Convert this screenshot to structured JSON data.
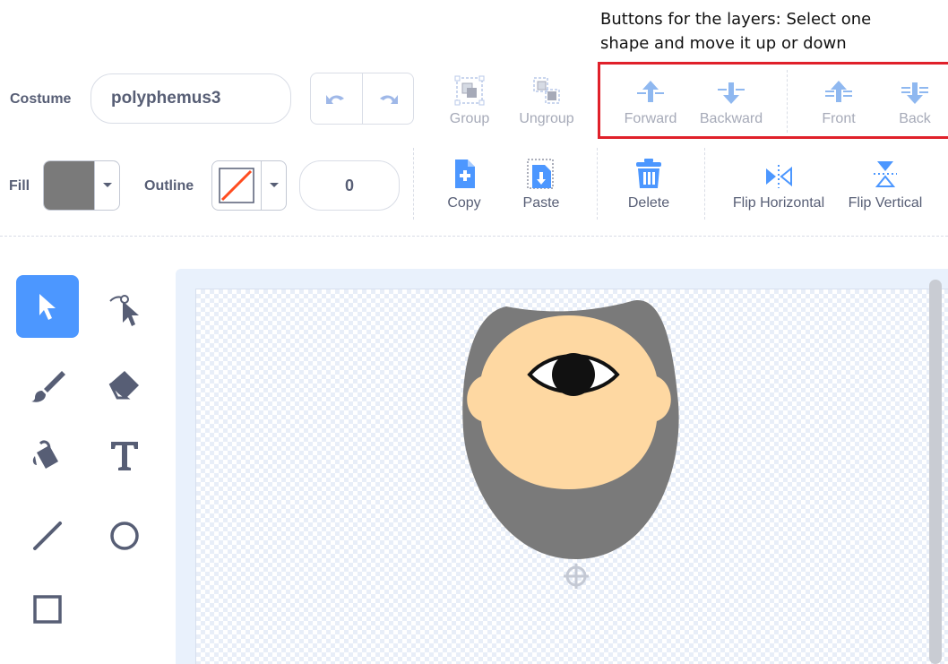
{
  "annotation": {
    "line1": "Buttons for the layers: Select one",
    "line2": "shape and move it up or down"
  },
  "costume": {
    "label": "Costume",
    "name_value": "polyphemus3"
  },
  "toolbar": {
    "group_label": "Group",
    "ungroup_label": "Ungroup",
    "forward_label": "Forward",
    "backward_label": "Backward",
    "front_label": "Front",
    "back_label": "Back",
    "copy_label": "Copy",
    "paste_label": "Paste",
    "delete_label": "Delete",
    "flip_horizontal_label": "Flip Horizontal",
    "flip_vertical_label": "Flip Vertical"
  },
  "fill": {
    "label": "Fill",
    "color": "#7a7a7a"
  },
  "outline": {
    "label": "Outline",
    "color": "none",
    "width_value": "0"
  },
  "tools": [
    {
      "name": "select-tool",
      "icon": "arrow-icon",
      "selected": true
    },
    {
      "name": "reshape-tool",
      "icon": "reshape-icon",
      "selected": false
    },
    {
      "name": "brush-tool",
      "icon": "brush-icon",
      "selected": false
    },
    {
      "name": "eraser-tool",
      "icon": "eraser-icon",
      "selected": false
    },
    {
      "name": "fill-tool",
      "icon": "fill-bucket-icon",
      "selected": false
    },
    {
      "name": "text-tool",
      "icon": "text-icon",
      "selected": false
    },
    {
      "name": "line-tool",
      "icon": "line-icon",
      "selected": false
    },
    {
      "name": "circle-tool",
      "icon": "circle-icon",
      "selected": false
    },
    {
      "name": "rectangle-tool",
      "icon": "rectangle-icon",
      "selected": false
    }
  ],
  "colors": {
    "accent": "#4c97ff",
    "text": "#575e75",
    "disabled": "#a6aab8",
    "highlight_box": "#e0202a",
    "beard": "#7a7a7a",
    "skin": "#fed8a2",
    "eye_white": "#ffffff",
    "pupil": "#111111"
  }
}
